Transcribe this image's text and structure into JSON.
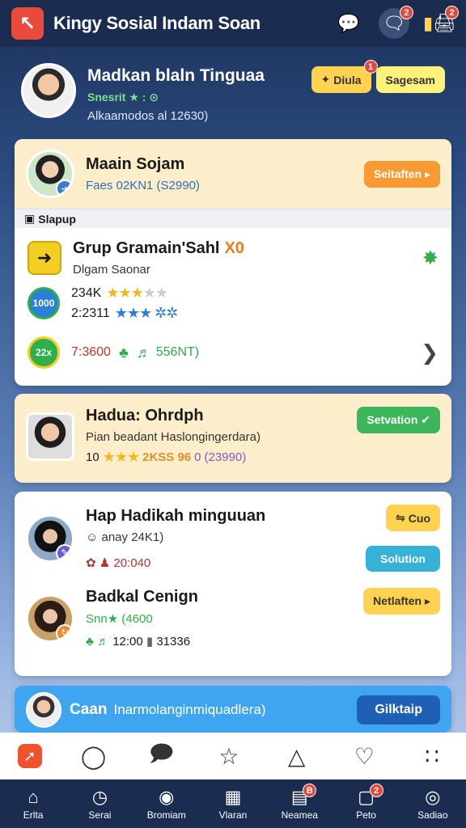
{
  "app": {
    "title": "Kingy Sosial Indam Soan",
    "badges": {
      "chat": "2",
      "cart": "2"
    }
  },
  "profile": {
    "name": "Madkan blaln Tinguaa",
    "status": "Snesrit ★ : ⊙",
    "meta": "Alkaamodos al 12630)",
    "action1": {
      "label": "Diula",
      "badge": "1"
    },
    "action2": {
      "label": "Sagesam"
    }
  },
  "card1": {
    "title": "Maain Sojam",
    "sub": "Faes 02KN1 (S2990)",
    "button": "Seitaften ▸",
    "section_label": "Slapup",
    "group": {
      "title": "Grup Gramain'Sahl",
      "suffix": "X0",
      "sub": "Dlgam Saonar",
      "rating1": "234K",
      "rating2": "2:2311",
      "count_a": "7:3600",
      "count_b": "556NT)",
      "round_icon1": "1000",
      "round_icon2": "22x"
    }
  },
  "card2": {
    "title": "Hadua: Ohrdph",
    "sub": "Pian beadant Haslongingerdara)",
    "meta_a": "10",
    "meta_b": "0",
    "meta_c": "(23990)",
    "meta_mid": "2KSS 96",
    "button": "Setvation ✔"
  },
  "card3": {
    "item1": {
      "title": "Hap Hadikah minguuan",
      "sub": "anay 24K1)",
      "stat": "20:040",
      "button1": "Cuo",
      "button2": "Solution"
    },
    "item2": {
      "title": "Badkal Cenign",
      "sub": "Snn★ (4600",
      "stat_a": "12:00",
      "stat_b": "31336",
      "button": "Netlaften ▸"
    }
  },
  "card4": {
    "title": "Caan",
    "text": "Inarmolanginmiquadlera)",
    "button": "Gilktaip"
  },
  "bottom_nav": [
    {
      "label": "Erlta"
    },
    {
      "label": "Serai"
    },
    {
      "label": "Bromiam"
    },
    {
      "label": "Vlaran"
    },
    {
      "label": "Neamea",
      "badge": "B"
    },
    {
      "label": "Peto",
      "badge": "2"
    },
    {
      "label": "Sadiao"
    }
  ]
}
